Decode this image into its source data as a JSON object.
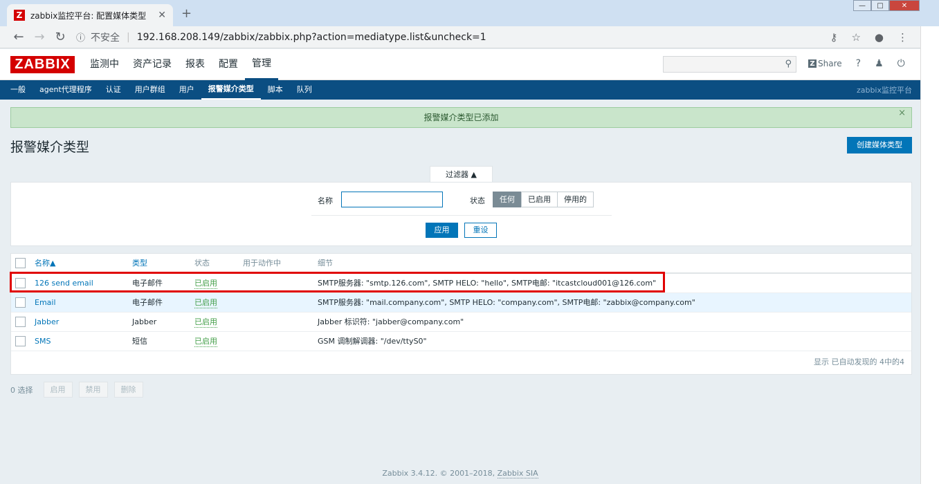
{
  "browser": {
    "tab_title": "zabbix监控平台: 配置媒体类型",
    "favicon_letter": "Z",
    "insecure_label": "不安全",
    "url": "192.168.208.149/zabbix/zabbix.php?action=mediatype.list&uncheck=1"
  },
  "header": {
    "logo": "ZABBIX",
    "nav": [
      "监测中",
      "资产记录",
      "报表",
      "配置",
      "管理"
    ],
    "active_nav": "管理",
    "share_label": "Share",
    "help": "?",
    "search_value": ""
  },
  "subnav": {
    "items": [
      "一般",
      "agent代理程序",
      "认证",
      "用户群组",
      "用户",
      "报警媒介类型",
      "脚本",
      "队列"
    ],
    "active": "报警媒介类型",
    "right_text": "zabbix监控平台"
  },
  "message": {
    "text": "报警媒介类型已添加",
    "close": "×"
  },
  "page": {
    "title": "报警媒介类型",
    "create_button": "创建媒体类型"
  },
  "filter": {
    "tab_label": "过滤器 ▲",
    "name_label": "名称",
    "name_value": "",
    "status_label": "状态",
    "status_options": [
      "任何",
      "已启用",
      "停用的"
    ],
    "status_selected": "任何",
    "apply": "应用",
    "reset": "重设"
  },
  "table": {
    "columns": [
      "名称▲",
      "类型",
      "状态",
      "用于动作中",
      "细节"
    ],
    "rows": [
      {
        "name": "126 send email",
        "type": "电子邮件",
        "status": "已启用",
        "used_in": "",
        "details": "SMTP服务器: \"smtp.126.com\", SMTP HELO: \"hello\", SMTP电邮: \"itcastcloud001@126.com\""
      },
      {
        "name": "Email",
        "type": "电子邮件",
        "status": "已启用",
        "used_in": "",
        "details": "SMTP服务器: \"mail.company.com\", SMTP HELO: \"company.com\", SMTP电邮: \"zabbix@company.com\""
      },
      {
        "name": "Jabber",
        "type": "Jabber",
        "status": "已启用",
        "used_in": "",
        "details": "Jabber 标识符: \"jabber@company.com\""
      },
      {
        "name": "SMS",
        "type": "短信",
        "status": "已启用",
        "used_in": "",
        "details": "GSM 调制解调器: \"/dev/ttyS0\""
      }
    ],
    "footer": "显示 已自动发现的 4中的4"
  },
  "actions": {
    "selected_count": "0 选择",
    "buttons": [
      "启用",
      "禁用",
      "删除"
    ]
  },
  "footer": {
    "text": "Zabbix 3.4.12. © 2001–2018, ",
    "link": "Zabbix SIA"
  },
  "colors": {
    "brand_red": "#d40000",
    "nav_blue": "#0b4e82",
    "primary": "#0275b8",
    "enabled_green": "#429e47",
    "highlight_red": "#e00000"
  }
}
